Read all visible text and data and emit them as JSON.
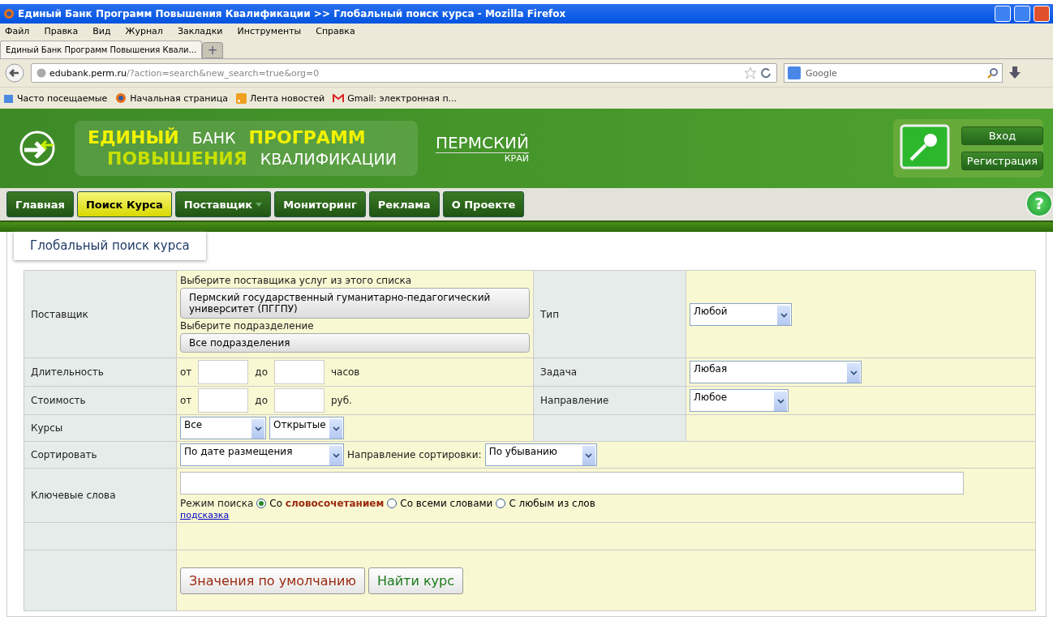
{
  "window": {
    "title": "Единый Банк Программ Повышения Квалификации >> Глобальный поиск курса - Mozilla Firefox"
  },
  "menu": [
    "Файл",
    "Правка",
    "Вид",
    "Журнал",
    "Закладки",
    "Инструменты",
    "Справка"
  ],
  "tabs": [
    {
      "label": "Единый Банк Программ Повышения Квали...",
      "selected": true
    }
  ],
  "new_tab": "+",
  "help": "?",
  "address": {
    "host": "edubank.perm.ru",
    "path": "/?action=search&new_search=true&org=0"
  },
  "search": {
    "placeholder": "Google"
  },
  "bookmarks": [
    {
      "label": "Часто посещаемые",
      "kind": "folder"
    },
    {
      "label": "Начальная страница",
      "kind": "firefox"
    },
    {
      "label": "Лента новостей",
      "kind": "rss"
    },
    {
      "label": "Gmail: электронная п...",
      "kind": "mail"
    }
  ],
  "site": {
    "logo": [
      {
        "text": "ЕДИНЫЙ",
        "kind": "yellow"
      },
      {
        "text": "БАНК",
        "kind": "white"
      },
      {
        "text": "ПРОГРАММ",
        "kind": "yellow"
      },
      {
        "text": "ПОВЫШЕНИЯ",
        "kind": "lime"
      },
      {
        "text": "КВАЛИФИКАЦИИ",
        "kind": "white"
      }
    ],
    "region": "ПЕРМСКИЙ",
    "region_sub": "КРАЙ",
    "auth": [
      "Вход",
      "Регистрация"
    ]
  },
  "nav": [
    {
      "label": "Главная",
      "selected": false,
      "dropdown": false
    },
    {
      "label": "Поиск Курса",
      "selected": true,
      "dropdown": false
    },
    {
      "label": "Поставщик",
      "selected": false,
      "dropdown": true
    },
    {
      "label": "Мониторинг",
      "selected": false,
      "dropdown": false
    },
    {
      "label": "Реклама",
      "selected": false,
      "dropdown": false
    },
    {
      "label": "О Проекте",
      "selected": false,
      "dropdown": false
    }
  ],
  "page_tab": "Глобальный поиск курса",
  "form": {
    "provider": {
      "label": "Поставщик",
      "hint": "Выберите поставщика услуг из этого списка",
      "value": "Пермский государственный гуманитарно-педагогический университет (ПГГПУ)",
      "sub_hint": "Выберите подразделение",
      "sub_value": "Все подразделения"
    },
    "type": {
      "label": "Тип",
      "value": "Любой"
    },
    "duration": {
      "label": "Длительность",
      "from": "от",
      "to": "до",
      "unit": "часов"
    },
    "task": {
      "label": "Задача",
      "value": "Любая"
    },
    "cost": {
      "label": "Стоимость",
      "from": "от",
      "to": "до",
      "unit": "руб."
    },
    "direction": {
      "label": "Направление",
      "value": "Любое"
    },
    "courses": {
      "label": "Курсы",
      "values": [
        "Все",
        "Открытые"
      ]
    },
    "sort": {
      "label": "Сортировать",
      "value": "По дате размещения",
      "order_label": "Направление сортировки:",
      "order_value": "По убыванию"
    },
    "keywords": {
      "label": "Ключевые слова",
      "mode_label": "Режим поиска",
      "modes": [
        {
          "label": "Со **словосочетанием**",
          "selected": true
        },
        {
          "label": "Со всеми словами",
          "selected": false
        },
        {
          "label": "С любым из слов",
          "selected": false
        }
      ],
      "hint_link": "подсказка"
    },
    "buttons": [
      {
        "label": "Значения по умолчанию",
        "kind": "reset"
      },
      {
        "label": "Найти курс",
        "kind": "submit"
      }
    ]
  }
}
